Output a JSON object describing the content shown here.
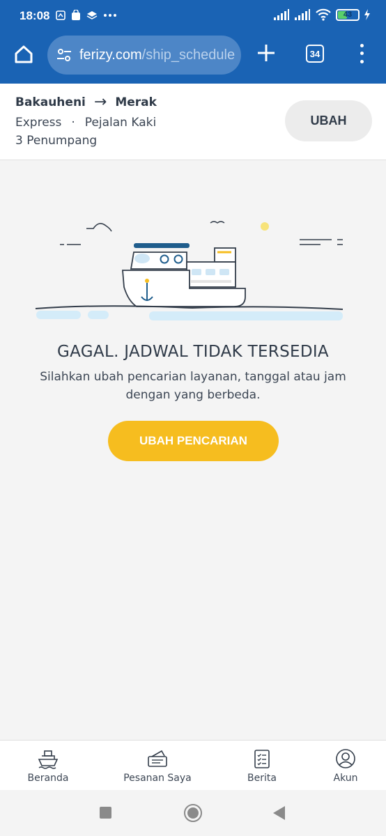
{
  "status_bar": {
    "time": "18:08",
    "battery": "43"
  },
  "browser": {
    "url_domain": "ferizy.com",
    "url_path": "/ship_schedule",
    "tab_count": "34"
  },
  "search": {
    "origin": "Bakauheni",
    "arrow": "→",
    "destination": "Merak",
    "service": "Express",
    "separator": "·",
    "passenger_type": "Pejalan Kaki",
    "passengers": "3 Penumpang",
    "change_label": "UBAH"
  },
  "empty_state": {
    "title": "GAGAL. JADWAL TIDAK TERSEDIA",
    "description": "Silahkan ubah pencarian layanan, tanggal atau jam dengan yang berbeda.",
    "cta_label": "UBAH PENCARIAN"
  },
  "bottom_nav": {
    "items": [
      {
        "label": "Beranda",
        "icon": "ship-icon"
      },
      {
        "label": "Pesanan Saya",
        "icon": "ticket-icon"
      },
      {
        "label": "Berita",
        "icon": "news-icon"
      },
      {
        "label": "Akun",
        "icon": "account-icon"
      }
    ]
  },
  "colors": {
    "browser_bar": "#1a63b4",
    "accent": "#f6bd1f",
    "text": "#2f3a48"
  }
}
